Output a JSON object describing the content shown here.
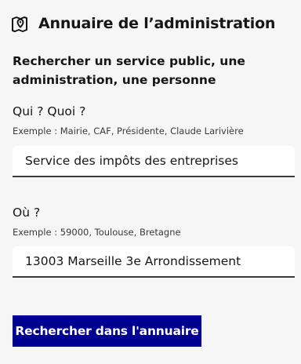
{
  "header": {
    "icon": "map-pin-icon",
    "title": "Annuaire de l’administration"
  },
  "subtitle": "Rechercher un service public, une administration, une personne",
  "what": {
    "label": "Qui ? Quoi ?",
    "hint": "Exemple : Mairie, CAF, Présidente, Claude Larivière",
    "value": "Service des impôts des entreprises"
  },
  "where": {
    "label": "Où ?",
    "hint": "Exemple : 59000, Toulouse, Bretagne",
    "value": "13003 Marseille 3e Arrondissement"
  },
  "search_button": {
    "label": "Rechercher dans l'annuaire"
  },
  "colors": {
    "primary": "#000091",
    "background": "#f6f6f6"
  }
}
